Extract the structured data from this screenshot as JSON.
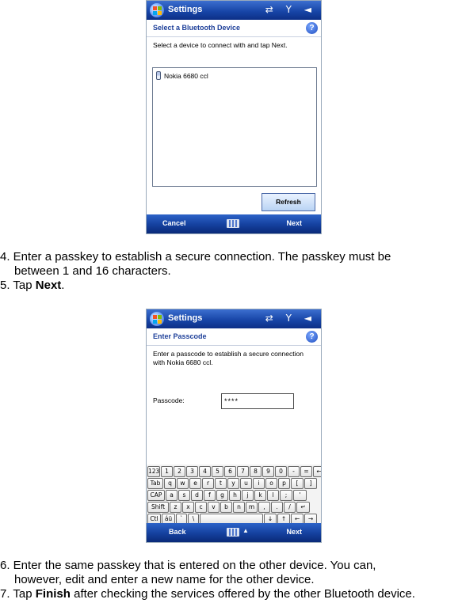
{
  "screen1": {
    "title": "Settings",
    "status_icons": "⇄ Y ◄",
    "header": "Select a Bluetooth Device",
    "help": "?",
    "instruction": "Select a device to connect with and tap Next.",
    "device": "Nokia 6680 ccl",
    "refresh": "Refresh",
    "menu_left": "Cancel",
    "menu_right": "Next"
  },
  "step4_line1": "4. Enter a passkey to establish a secure connection. The passkey must be",
  "step4_line2": "between 1 and 16 characters.",
  "step5_prefix": "5. Tap ",
  "step5_bold": "Next",
  "step5_suffix": ".",
  "screen2": {
    "title": "Settings",
    "status_icons": "⇄ Y ◄",
    "header": "Enter Passcode",
    "help": "?",
    "instruction": "Enter a passcode to establish a secure connection with Nokia 6680 ccl.",
    "passcode_label": "Passcode:",
    "passcode_value": "****",
    "menu_left": "Back",
    "menu_right": "Next",
    "keyboard": {
      "row1": [
        "123",
        "1",
        "2",
        "3",
        "4",
        "5",
        "6",
        "7",
        "8",
        "9",
        "0",
        "-",
        "=",
        "←"
      ],
      "row2": [
        "Tab",
        "q",
        "w",
        "e",
        "r",
        "t",
        "y",
        "u",
        "i",
        "o",
        "p",
        "[",
        "]"
      ],
      "row3": [
        "CAP",
        "a",
        "s",
        "d",
        "f",
        "g",
        "h",
        "j",
        "k",
        "l",
        ";",
        "'"
      ],
      "row4": [
        "Shift",
        "z",
        "x",
        "c",
        "v",
        "b",
        "n",
        "m",
        ",",
        ".",
        "/",
        "↵"
      ],
      "row5": [
        "Ctl",
        "áü",
        "`",
        "\\",
        "",
        "↓",
        "↑",
        "←",
        "→"
      ]
    }
  },
  "step6_line1": "6. Enter the same passkey that is entered on the other device. You can,",
  "step6_line2": "however, edit and enter a new name for the other device.",
  "step7_prefix": "7. Tap ",
  "step7_bold": "Finish",
  "step7_suffix": " after checking the services offered by the other Bluetooth device."
}
